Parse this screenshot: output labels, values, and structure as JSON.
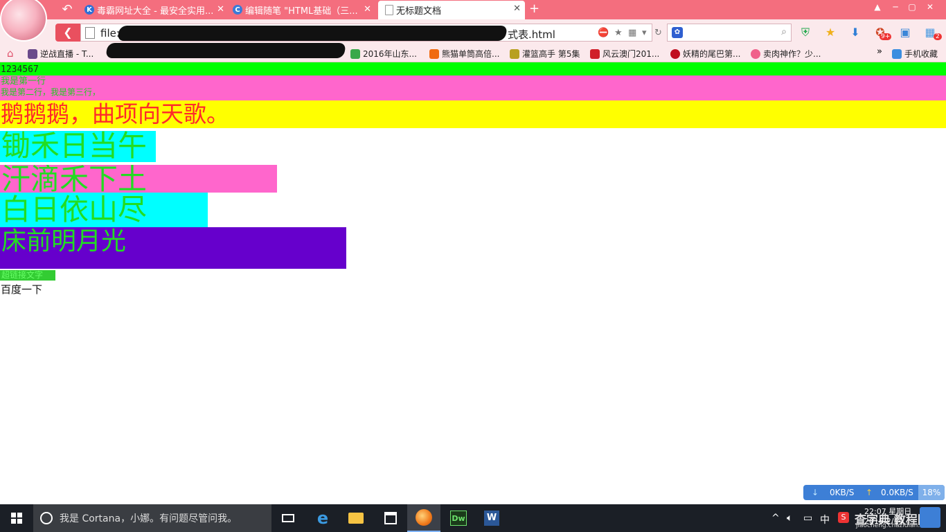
{
  "browser": {
    "tabs": [
      {
        "label": "毒霸网址大全 - 最安全实用...",
        "icon": "k-icon",
        "active": false
      },
      {
        "label": "编辑随笔 \"HTML基础（三...",
        "icon": "c-icon",
        "active": false
      },
      {
        "label": "无标题文档",
        "icon": "doc-icon",
        "active": true
      }
    ],
    "new_tab": "+",
    "url_prefix": "file:",
    "url_suffix": "式表.html",
    "bookmarks": [
      {
        "label": "逆战直播 - T...",
        "icon": "nz-icon"
      },
      {
        "label": "2016年山东...",
        "icon": "sd-icon"
      },
      {
        "label": "熊猫单筒高倍...",
        "icon": "taobao-icon"
      },
      {
        "label": "灌篮高手 第5集",
        "icon": "dunk-icon"
      },
      {
        "label": "风云澳门201...",
        "icon": "fy-icon"
      },
      {
        "label": "妖精的尾巴第...",
        "icon": "play-icon"
      },
      {
        "label": "卖肉神作？少...",
        "icon": "heart-icon"
      }
    ],
    "bookmarks_more": "»",
    "mobile_favorites": "手机收藏",
    "search_badge": "9+",
    "apps_badge": "2"
  },
  "page": {
    "line1": "1234567",
    "line2a": "我是第一行",
    "line2b": "我是第二行，我是第三行，",
    "poem_title": "鹅鹅鹅，曲项向天歌。",
    "block1": "锄禾日当午",
    "block2": "汗滴禾下土",
    "block3": "白日依山尽",
    "block4": "床前明月光",
    "small_link": "超链接文字",
    "baidu": "百度一下"
  },
  "speed": {
    "down": "0KB/S",
    "up": "0.0KB/S",
    "percent": "18%"
  },
  "taskbar": {
    "cortana": "我是 Cortana，小娜。有问题尽管问我。",
    "ime": "中",
    "clock_time": "22:07 星期日",
    "clock_date": "2016/2/14",
    "watermark": "查字典 教程网",
    "watermark_url": "jiaocheng.chazidian.com"
  },
  "colors": {
    "titlebar": "#f46e7e",
    "green": "#00ff00",
    "pink": "#ff66cc",
    "yellow": "#ffff00",
    "cyan": "#00ffff",
    "purple": "#6600cc"
  }
}
